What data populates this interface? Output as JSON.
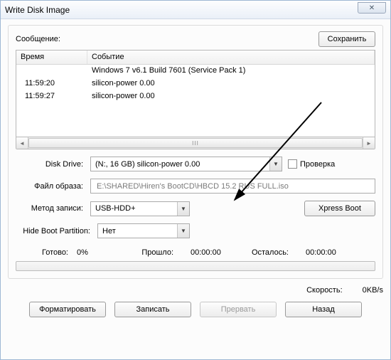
{
  "window": {
    "title": "Write Disk Image"
  },
  "message_label": "Сообщение:",
  "save_btn": "Сохранить",
  "log": {
    "col_time": "Время",
    "col_event": "Событие",
    "rows": [
      {
        "time": "",
        "event": "Windows 7 v6.1 Build 7601 (Service Pack 1)"
      },
      {
        "time": "11:59:20",
        "event": "silicon-power   0.00"
      },
      {
        "time": "11:59:27",
        "event": "silicon-power   0.00"
      }
    ]
  },
  "disk_drive": {
    "label": "Disk Drive:",
    "value": "(N:, 16 GB)     silicon-power   0.00",
    "check_label": "Проверка"
  },
  "image_file": {
    "label": "Файл образа:",
    "value": "E:\\SHARED\\Hiren's BootCD\\HBCD 15.2 RUS FULL.iso"
  },
  "write_method": {
    "label": "Метод записи:",
    "value": "USB-HDD+"
  },
  "xpress_btn": "Xpress Boot",
  "hide_boot": {
    "label": "Hide Boot Partition:",
    "value": "Нет"
  },
  "status": {
    "ready_label": "Готово:",
    "ready_value": "0%",
    "elapsed_label": "Прошло:",
    "elapsed_value": "00:00:00",
    "remain_label": "Осталось:",
    "remain_value": "00:00:00"
  },
  "speed": {
    "label": "Скорость:",
    "value": "0KB/s"
  },
  "buttons": {
    "format": "Форматировать",
    "write": "Записать",
    "abort": "Прервать",
    "back": "Назад"
  },
  "scroll_thumb": "III"
}
